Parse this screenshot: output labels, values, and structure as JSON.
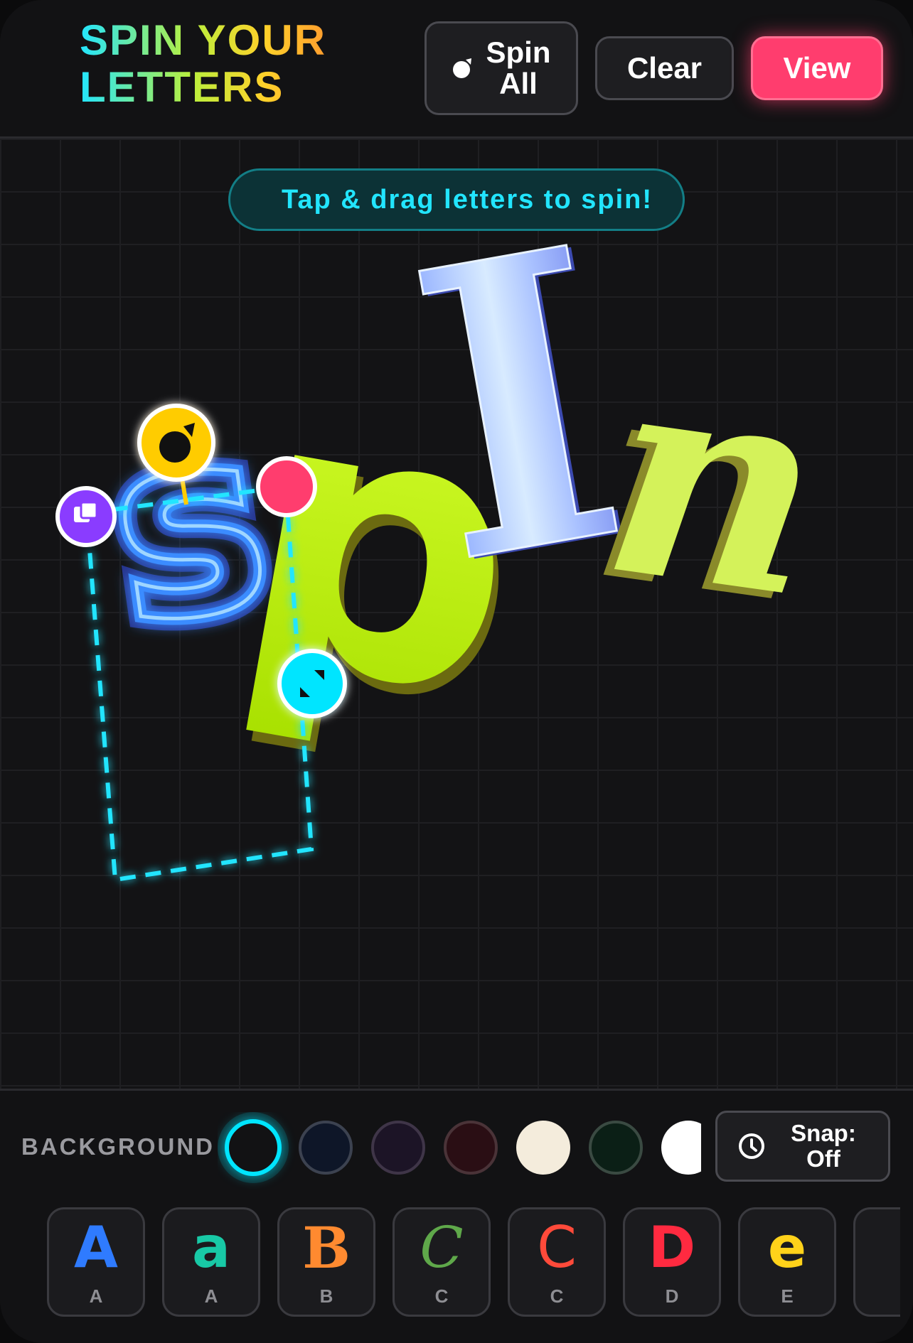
{
  "header": {
    "title_line1": "SPIN YOUR",
    "title_line2": "LETTERS",
    "spin_all_label_1": "Spin",
    "spin_all_label_2": "All",
    "clear_label": "Clear",
    "view_label": "View"
  },
  "canvas": {
    "hint": "Tap & drag letters to spin!",
    "letters": [
      {
        "char": "s",
        "style": "neon blue outline",
        "color": "#3a8dff",
        "selected": true
      },
      {
        "char": "p",
        "style": "lime 3D",
        "color": "#c8ff1a"
      },
      {
        "char": "I",
        "style": "chrome blue serif",
        "color": "#bcd3ff"
      },
      {
        "char": "n",
        "style": "lime serif 3D",
        "color": "#d4f25a"
      }
    ],
    "handles": [
      "rotate-handle",
      "duplicate-handle",
      "delete-handle",
      "resize-handle"
    ]
  },
  "panel": {
    "background_label": "BACKGROUND",
    "swatches": [
      {
        "color": "#121214",
        "selected": true
      },
      {
        "color": "#0e1628",
        "selected": false
      },
      {
        "color": "#1c1426",
        "selected": false
      },
      {
        "color": "#2a0e14",
        "selected": false
      },
      {
        "color": "#f4ecdc",
        "selected": false
      },
      {
        "color": "#0b1f16",
        "selected": false
      },
      {
        "color": "#ffffff",
        "selected": false
      }
    ],
    "snap_label_1": "Snap:",
    "snap_label_2": "Off",
    "letter_tiles": [
      {
        "glyph": "A",
        "caption": "A",
        "color": "#2f7bff"
      },
      {
        "glyph": "a",
        "caption": "A",
        "color": "#18c9a6"
      },
      {
        "glyph": "B",
        "caption": "B",
        "color": "#ff8a30"
      },
      {
        "glyph": "C",
        "caption": "C",
        "color": "#5fa84a"
      },
      {
        "glyph": "C",
        "caption": "C",
        "color": "#ff4a3a"
      },
      {
        "glyph": "D",
        "caption": "D",
        "color": "#ff2a40"
      },
      {
        "glyph": "e",
        "caption": "E",
        "color": "#ffd21a"
      }
    ]
  }
}
